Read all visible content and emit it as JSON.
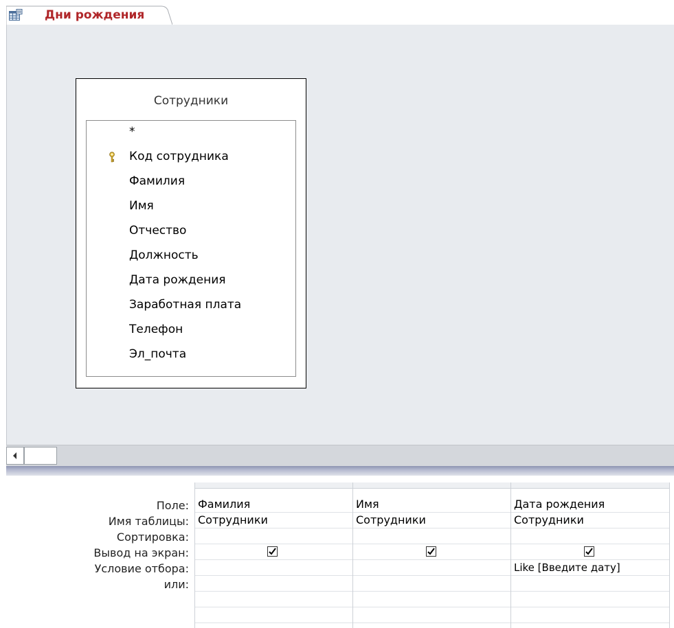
{
  "tab": {
    "title": "Дни рождения",
    "icon": "query-icon"
  },
  "table": {
    "name": "Сотрудники",
    "fields": [
      "*",
      "Код сотрудника",
      "Фамилия",
      "Имя",
      "Отчество",
      "Должность",
      "Дата рождения",
      "Заработная плата",
      "Телефон",
      "Эл_почта"
    ],
    "primary_key_field": "Код сотрудника",
    "primary_key_icon": "key-icon"
  },
  "grid": {
    "row_labels": [
      "Поле:",
      "Имя таблицы:",
      "Сортировка:",
      "Вывод на экран:",
      "Условие отбора:",
      "или:"
    ],
    "columns": [
      {
        "field": "Фамилия",
        "table": "Сотрудники",
        "sort": "",
        "show": true,
        "criteria": "",
        "or": ""
      },
      {
        "field": "Имя",
        "table": "Сотрудники",
        "sort": "",
        "show": true,
        "criteria": "",
        "or": ""
      },
      {
        "field": "Дата рождения",
        "table": "Сотрудники",
        "sort": "",
        "show": true,
        "criteria": "Like [Введите дату]",
        "or": ""
      }
    ]
  },
  "scroll": {
    "left_arrow_icon": "scroll-left-arrow-icon"
  },
  "colors": {
    "tab_title": "#b0272a",
    "design_bg": "#e8ebef",
    "splitter": "#8e95b2"
  }
}
